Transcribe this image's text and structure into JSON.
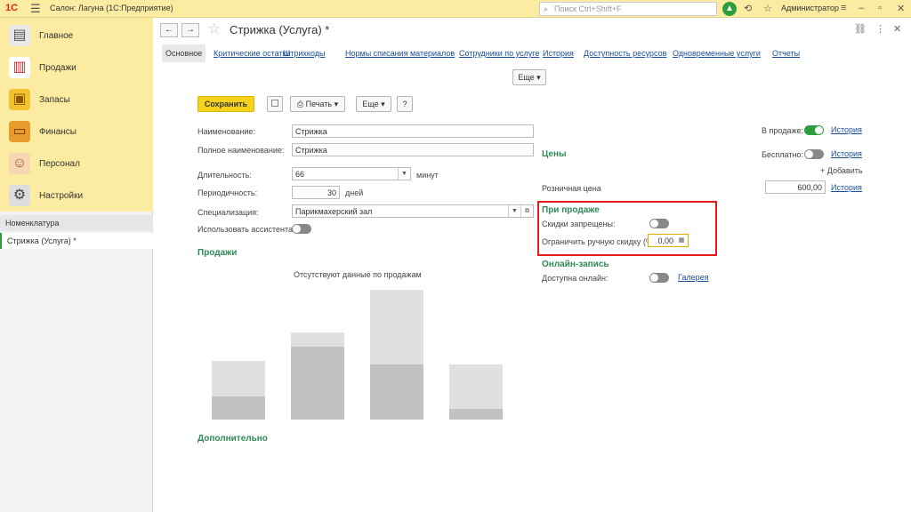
{
  "topbar": {
    "logo": "1С",
    "app_title": "Салон: Лагуна  (1С:Предприятие)",
    "search_placeholder": "Поиск Ctrl+Shift+F",
    "user": "Администратор"
  },
  "sidebar": {
    "items": [
      {
        "label": "Главное",
        "icon": "clipboard-icon"
      },
      {
        "label": "Продажи",
        "icon": "chart-icon"
      },
      {
        "label": "Запасы",
        "icon": "boxes-icon"
      },
      {
        "label": "Финансы",
        "icon": "wallet-icon"
      },
      {
        "label": "Персонал",
        "icon": "people-icon"
      },
      {
        "label": "Настройки",
        "icon": "gear-icon"
      }
    ],
    "section": "Номенклатура",
    "open_item": "Стрижка (Услуга) *"
  },
  "document": {
    "title": "Стрижка (Услуга) *",
    "tabs": [
      "Основное",
      "Критические остатки",
      "Штрихкоды",
      "Нормы списания материалов",
      "Сотрудники по услуге",
      "История",
      "Доступность ресурсов",
      "Одновременные услуги",
      "Отчеты"
    ],
    "more_label": "Еще"
  },
  "toolbar": {
    "save_label": "Сохранить",
    "print_label": "Печать",
    "more_label": "Еще",
    "help_label": "?"
  },
  "form": {
    "name_label": "Наименование:",
    "name_value": "Стрижка",
    "fullname_label": "Полное наименование:",
    "fullname_value": "Стрижка",
    "duration_label": "Длительность:",
    "duration_value": "66",
    "duration_unit": "минут",
    "period_label": "Периодичность:",
    "period_value": "30",
    "period_unit": "дней",
    "spec_label": "Специализация:",
    "spec_value": "Парикмахерский зал",
    "assistant_label": "Использовать ассистента:"
  },
  "right": {
    "on_sale_label": "В продаже:",
    "history_label": "История",
    "prices_section": "Цены",
    "free_label": "Бесплатно:",
    "add_label": "+ Добавить",
    "retail_label": "Розничная цена",
    "retail_value": "600,00",
    "on_sale_section": "При продаже",
    "discounts_label": "Скидки запрещены:",
    "limit_label": "Ограничить ручную скидку (%):",
    "limit_value": "0,00",
    "online_section": "Онлайн-запись",
    "online_label": "Доступна онлайн:",
    "gallery_label": "Галерея"
  },
  "sales": {
    "section": "Продажи",
    "no_data": "Отсутствуют данные по продажам"
  },
  "extra_section": "Дополнительно",
  "colors": {
    "accent": "#f7d21c",
    "green": "#2e9d3b",
    "highlight": "#e31b1b"
  }
}
